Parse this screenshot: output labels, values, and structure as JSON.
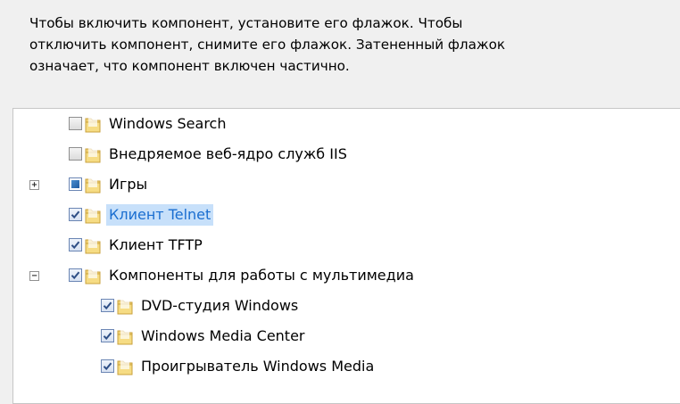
{
  "description": [
    "Чтобы включить компонент, установите его флажок. Чтобы",
    "отключить компонент, снимите его флажок. Затененный флажок",
    "означает, что компонент включен частично."
  ],
  "features": [
    {
      "label": "Windows Search",
      "state": "unchecked",
      "expander": "",
      "level": 0,
      "selected": false
    },
    {
      "label": "Внедряемое веб-ядро служб IIS",
      "state": "unchecked",
      "expander": "",
      "level": 0,
      "selected": false
    },
    {
      "label": "Игры",
      "state": "partial",
      "expander": "+",
      "level": 0,
      "selected": false
    },
    {
      "label": "Клиент Telnet",
      "state": "checked",
      "expander": "",
      "level": 0,
      "selected": true
    },
    {
      "label": "Клиент TFTP",
      "state": "checked",
      "expander": "",
      "level": 0,
      "selected": false
    },
    {
      "label": "Компоненты для работы с мультимедиа",
      "state": "checked",
      "expander": "−",
      "level": 0,
      "selected": false
    },
    {
      "label": "DVD-студия Windows",
      "state": "checked",
      "expander": "",
      "level": 1,
      "selected": false
    },
    {
      "label": "Windows Media Center",
      "state": "checked",
      "expander": "",
      "level": 1,
      "selected": false
    },
    {
      "label": "Проигрыватель Windows Media",
      "state": "checked",
      "expander": "",
      "level": 1,
      "selected": false
    }
  ],
  "colors": {
    "selection": "#c7e0fa",
    "checkbox_border": "#6b86b4",
    "folder": "#e8c15a"
  },
  "icons": {
    "checkbox": "checkbox-icon",
    "folder": "folder-icon",
    "expand": "expand-icon",
    "collapse": "collapse-icon"
  }
}
